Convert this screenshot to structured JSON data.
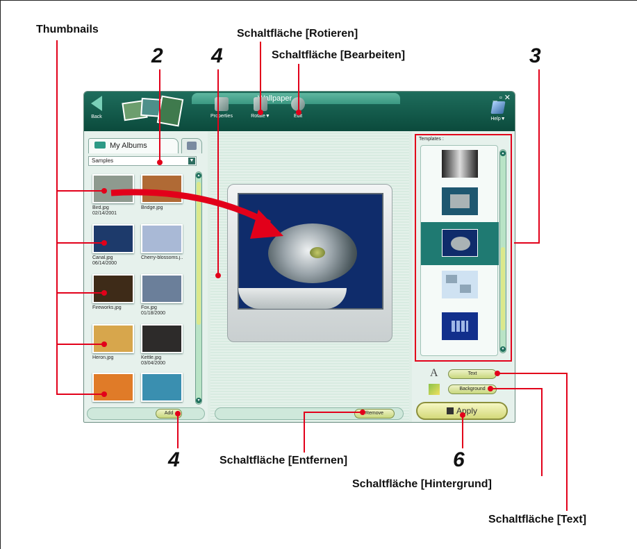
{
  "callouts": {
    "thumbnails": "Thumbnails",
    "rotate": "Schaltfläche [Rotieren]",
    "edit": "Schaltfläche [Bearbeiten]",
    "remove": "Schaltfläche [Entfernen]",
    "background": "Schaltfläche [Hintergrund]",
    "text": "Schaltfläche [Text]"
  },
  "numbers": {
    "n2": "2",
    "n4_top": "4",
    "n3": "3",
    "n4_bottom": "4",
    "n6": "6"
  },
  "window": {
    "title": "Wallpaper",
    "controls": "_ ▫ ✕",
    "back_label": "Back",
    "toolbar": {
      "properties": "Properties",
      "rotate": "Rotate▼",
      "edit": "Edit",
      "help": "Help▼"
    }
  },
  "left_panel": {
    "tab_label": "My Albums",
    "select_value": "Samples",
    "thumbnails": [
      {
        "name": "Bird.jpg",
        "date": "02/14/2001",
        "color": "#8e9a8f"
      },
      {
        "name": "Bridge.jpg",
        "date": "",
        "color": "#b06a35"
      },
      {
        "name": "Canal.jpg",
        "date": "06/14/2000",
        "color": "#1d3a6b"
      },
      {
        "name": "Cherry-blossoms.j...",
        "date": "",
        "color": "#a9b9d6"
      },
      {
        "name": "Fireworks.jpg",
        "date": "",
        "color": "#3e2b18"
      },
      {
        "name": "Fox.jpg",
        "date": "01/18/2000",
        "color": "#6b7f9a"
      },
      {
        "name": "Heron.jpg",
        "date": "",
        "color": "#d7a64c"
      },
      {
        "name": "Kettle.jpg",
        "date": "03/04/2000",
        "color": "#2d2b2a"
      },
      {
        "name": "",
        "date": "",
        "color": "#e07b28"
      },
      {
        "name": "",
        "date": "",
        "color": "#3a8fb0"
      }
    ],
    "add_label": "Add"
  },
  "center_panel": {
    "remove_label": "Remove"
  },
  "right_panel": {
    "templates_label": "Templates :",
    "text_label": "Text",
    "background_label": "Background",
    "apply_label": "Apply"
  },
  "colors": {
    "accent_red": "#e2001a",
    "titlebar": "#0b4a3c",
    "selected_template": "#1f7a72"
  }
}
